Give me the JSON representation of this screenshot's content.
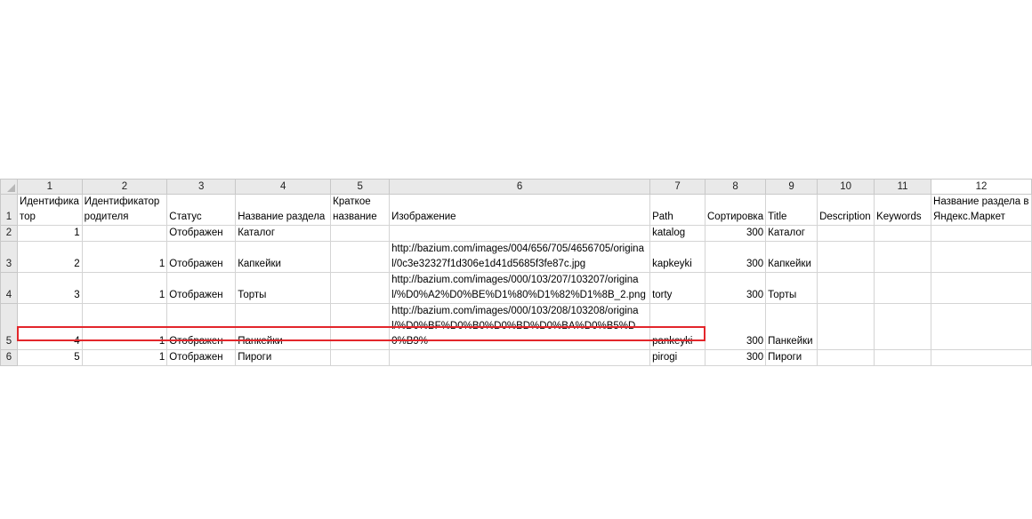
{
  "column_headers": [
    "1",
    "2",
    "3",
    "4",
    "5",
    "6",
    "7",
    "8",
    "9",
    "10",
    "11",
    "12"
  ],
  "row_headers": [
    "1",
    "2",
    "3",
    "4",
    "5",
    "6"
  ],
  "header_row": {
    "c1": "Идентификатор",
    "c2": "Идентификатор родителя",
    "c3": "Статус",
    "c4": "Название раздела",
    "c5": "Краткое название",
    "c6": "Изображение",
    "c7": "Path",
    "c8": "Сортировка",
    "c9": "Title",
    "c10": "Description",
    "c11": "Keywords",
    "c12": "Название раздела в Яндекс.Маркет"
  },
  "rows": [
    {
      "c1": "1",
      "c2": "",
      "c3": "Отображен",
      "c4": "Каталог",
      "c5": "",
      "c6": "",
      "c7": "katalog",
      "c8": "300",
      "c9": "Каталог"
    },
    {
      "c1": "2",
      "c2": "1",
      "c3": "Отображен",
      "c4": "Капкейки",
      "c5": "",
      "c6": "http://bazium.com/images/004/656/705/4656705/original/0c3e32327f1d306e1d41d5685f3fe87c.jpg",
      "c7": "kapkeyki",
      "c8": "300",
      "c9": "Капкейки"
    },
    {
      "c1": "3",
      "c2": "1",
      "c3": "Отображен",
      "c4": "Торты",
      "c5": "",
      "c6": "http://bazium.com/images/000/103/207/103207/original/%D0%A2%D0%BE%D1%80%D1%82%D1%8B_2.png",
      "c7": "torty",
      "c8": "300",
      "c9": "Торты"
    },
    {
      "c1": "4",
      "c2": "1",
      "c3": "Отображен",
      "c4": "Панкейки",
      "c5": "",
      "c6": "http://bazium.com/images/000/103/208/103208/original/%D0%BF%D0%B0%D0%BD%D0%BA%D0%B5%D0%B9%",
      "c7": "pankeyki",
      "c8": "300",
      "c9": "Панкейки"
    },
    {
      "c1": "5",
      "c2": "1",
      "c3": "Отображен",
      "c4": "Пироги",
      "c5": "",
      "c6": "",
      "c7": "pirogi",
      "c8": "300",
      "c9": "Пироги"
    }
  ],
  "colors": {
    "selection_border": "#e3262b",
    "header_bg": "#e9e9e9",
    "grid": "#d4d4d4"
  }
}
